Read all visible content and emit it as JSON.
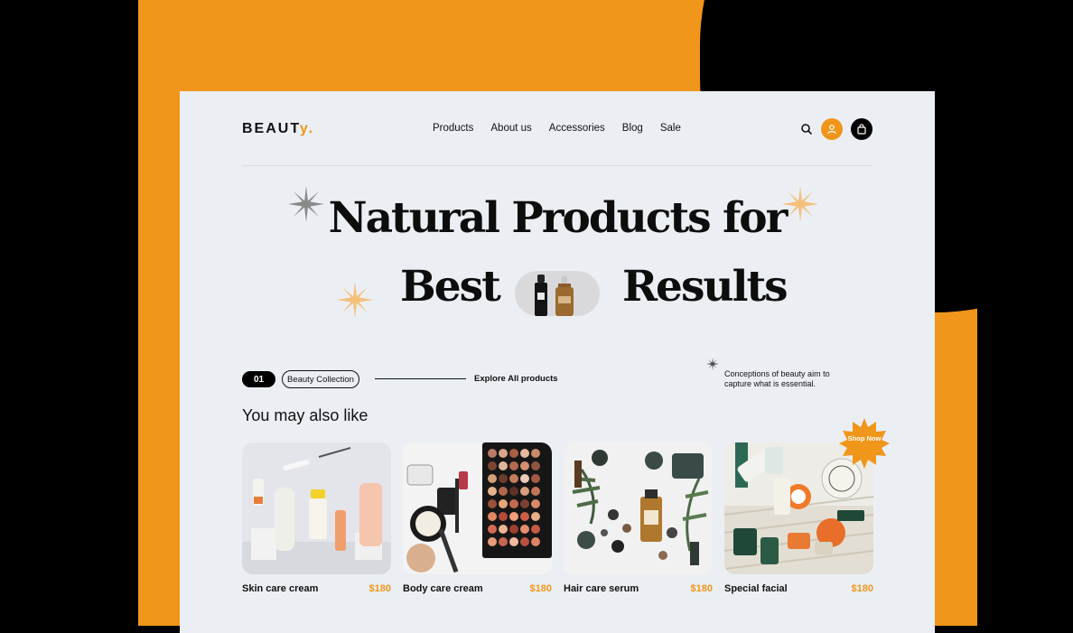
{
  "brand": {
    "name": "BEAUT",
    "accent": "y."
  },
  "nav": {
    "items": [
      "Products",
      "About us",
      "Accessories",
      "Blog",
      "Sale"
    ]
  },
  "hero": {
    "line1": "Natural Products for",
    "best": "Best",
    "results": "Results"
  },
  "collection": {
    "number": "01",
    "label": "Beauty Collection",
    "explore": "Explore All products",
    "tagline": "Conceptions of beauty aim to capture what is essential."
  },
  "section_title": "You may also like",
  "shop_now": "Shop Now",
  "products": [
    {
      "name": "Skin care cream",
      "price": "$180"
    },
    {
      "name": "Body care cream",
      "price": "$180"
    },
    {
      "name": "Hair care serum",
      "price": "$180"
    },
    {
      "name": "Special facial",
      "price": "$180"
    }
  ],
  "colors": {
    "accent": "#F0961A",
    "background": "#EBEFF3",
    "text": "#111111"
  },
  "icons": [
    "search-icon",
    "user-icon",
    "shopping-bag-icon",
    "sparkle-icon"
  ]
}
